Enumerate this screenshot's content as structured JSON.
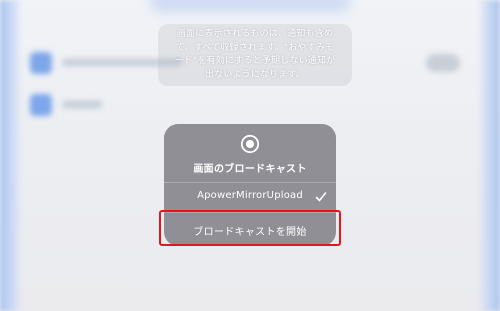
{
  "description": {
    "lines": [
      "画面に表示されるものは、通知も含め",
      "て、すべて収録されます。\"おやすみモ",
      "ード\"を有効にすると予期しない通知が",
      "出ないようになります。"
    ]
  },
  "broadcast_panel": {
    "title": "画面のブロードキャスト",
    "record_icon": "record-icon",
    "selected_option": {
      "label": "ApowerMirrorUpload",
      "check_icon": "checkmark-icon"
    },
    "start_button": {
      "label": "ブロードキャストを開始"
    }
  },
  "highlight": {
    "color": "#e3161c",
    "target": "start_button"
  },
  "colors": {
    "panel_background": "#88888e",
    "text": "#ffffff",
    "background_accent": "#7ea6ea"
  }
}
